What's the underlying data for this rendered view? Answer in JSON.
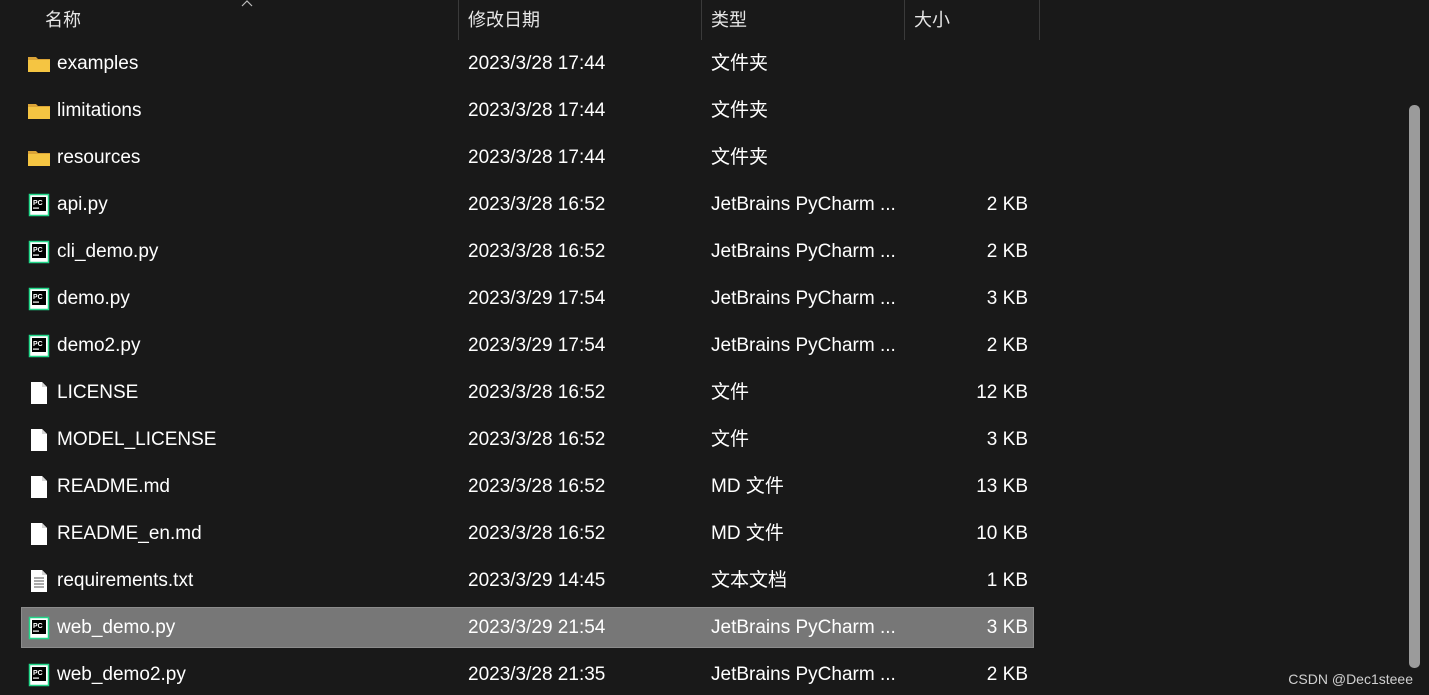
{
  "columns": {
    "name": "名称",
    "date": "修改日期",
    "type": "类型",
    "size": "大小"
  },
  "files": [
    {
      "name": "examples",
      "date": "2023/3/28 17:44",
      "type": "文件夹",
      "size": "",
      "icon": "folder-icon",
      "selected": false
    },
    {
      "name": "limitations",
      "date": "2023/3/28 17:44",
      "type": "文件夹",
      "size": "",
      "icon": "folder-icon",
      "selected": false
    },
    {
      "name": "resources",
      "date": "2023/3/28 17:44",
      "type": "文件夹",
      "size": "",
      "icon": "folder-icon",
      "selected": false
    },
    {
      "name": "api.py",
      "date": "2023/3/28 16:52",
      "type": "JetBrains PyCharm ...",
      "size": "2 KB",
      "icon": "pycharm-icon",
      "selected": false
    },
    {
      "name": "cli_demo.py",
      "date": "2023/3/28 16:52",
      "type": "JetBrains PyCharm ...",
      "size": "2 KB",
      "icon": "pycharm-icon",
      "selected": false
    },
    {
      "name": "demo.py",
      "date": "2023/3/29 17:54",
      "type": "JetBrains PyCharm ...",
      "size": "3 KB",
      "icon": "pycharm-icon",
      "selected": false
    },
    {
      "name": "demo2.py",
      "date": "2023/3/29 17:54",
      "type": "JetBrains PyCharm ...",
      "size": "2 KB",
      "icon": "pycharm-icon",
      "selected": false
    },
    {
      "name": "LICENSE",
      "date": "2023/3/28 16:52",
      "type": "文件",
      "size": "12 KB",
      "icon": "file-icon",
      "selected": false
    },
    {
      "name": "MODEL_LICENSE",
      "date": "2023/3/28 16:52",
      "type": "文件",
      "size": "3 KB",
      "icon": "file-icon",
      "selected": false
    },
    {
      "name": "README.md",
      "date": "2023/3/28 16:52",
      "type": "MD 文件",
      "size": "13 KB",
      "icon": "file-icon",
      "selected": false
    },
    {
      "name": "README_en.md",
      "date": "2023/3/28 16:52",
      "type": "MD 文件",
      "size": "10 KB",
      "icon": "file-icon",
      "selected": false
    },
    {
      "name": "requirements.txt",
      "date": "2023/3/29 14:45",
      "type": "文本文档",
      "size": "1 KB",
      "icon": "text-file-icon",
      "selected": false
    },
    {
      "name": "web_demo.py",
      "date": "2023/3/29 21:54",
      "type": "JetBrains PyCharm ...",
      "size": "3 KB",
      "icon": "pycharm-icon",
      "selected": true
    },
    {
      "name": "web_demo2.py",
      "date": "2023/3/28 21:35",
      "type": "JetBrains PyCharm ...",
      "size": "2 KB",
      "icon": "pycharm-icon",
      "selected": false
    }
  ],
  "watermark": "CSDN @Dec1steee",
  "colors": {
    "background": "#191919",
    "selected_row": "#777777",
    "folder": "#f5c542",
    "pycharm_green": "#21d789"
  }
}
